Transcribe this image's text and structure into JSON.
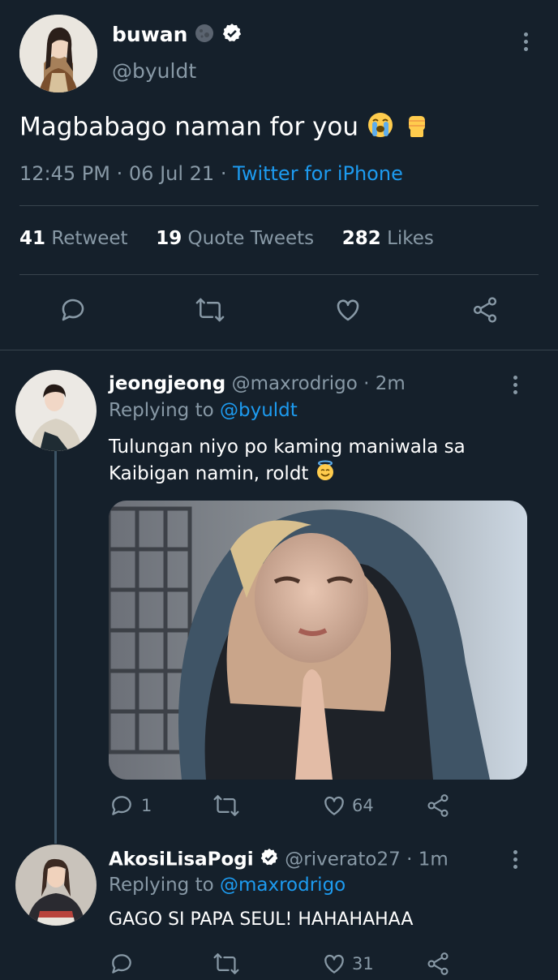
{
  "main_tweet": {
    "display_name": "buwan",
    "handle": "@byuldt",
    "moon_emoji": "moon-emoji",
    "text": "Magbabago naman for you",
    "emoji_1": "loudly-crying-face-emoji",
    "emoji_2": "raised-fist-emoji",
    "time": "12:45 PM",
    "date": "06 Jul 21",
    "source": "Twitter for iPhone",
    "stats": {
      "retweets": "41",
      "retweets_label": "Retweet",
      "quotes": "19",
      "quotes_label": "Quote Tweets",
      "likes": "282",
      "likes_label": "Likes"
    }
  },
  "replies": [
    {
      "display_name": "jeongjeong",
      "handle": "@maxrodrigo",
      "time": "2m",
      "replying_prefix": "Replying to",
      "replying_to": "@byuldt",
      "text_line_1": "Tulungan niyo po kaming maniwala sa",
      "text_line_2": "Kaibigan namin, roldt",
      "emoji": "smiling-face-with-halo-emoji",
      "reply_count": "1",
      "retweet_count": "",
      "like_count": "64"
    },
    {
      "display_name": "AkosiLisaPogi",
      "handle": "@riverato27",
      "time": "1m",
      "replying_prefix": "Replying to",
      "replying_to": "@maxrodrigo",
      "text": "GAGO SI PAPA SEUL! HAHAHAHAA",
      "reply_count": "",
      "retweet_count": "",
      "like_count": "31"
    }
  ],
  "colors": {
    "background": "#15202b",
    "muted": "#8899a6",
    "link": "#1d9bf0",
    "divider": "#38444d"
  }
}
